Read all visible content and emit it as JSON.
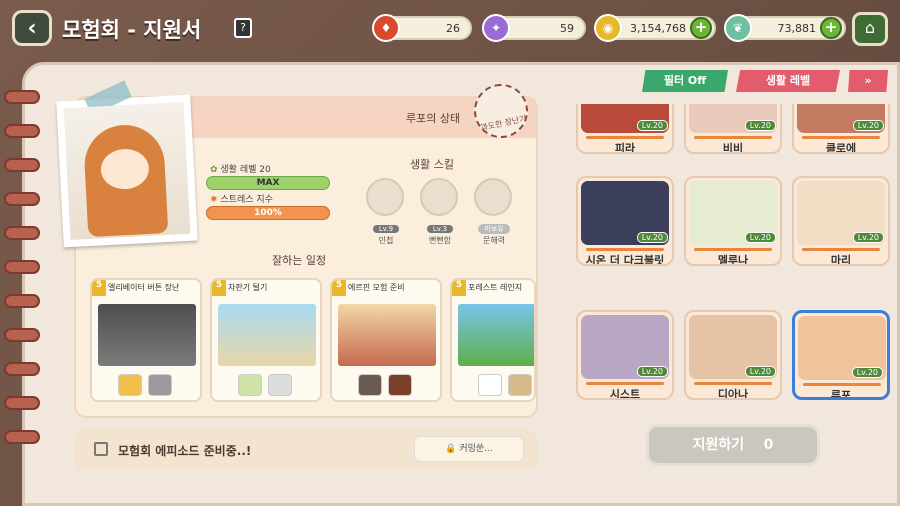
{
  "header": {
    "title": "모험회 - 지원서",
    "help": "?"
  },
  "currencies": [
    {
      "icon": "lantern-icon",
      "value": "26",
      "color": "#d94a2c"
    },
    {
      "icon": "purple-gem-icon",
      "value": "59",
      "color": "#9c6ad6"
    },
    {
      "icon": "gold-coin-icon",
      "value": "3,154,768",
      "color": "#e6b82a"
    },
    {
      "icon": "leaf-icon",
      "value": "73,881",
      "color": "#6ec0a0"
    }
  ],
  "status": {
    "title": "루포의 상태",
    "stamp": "과도한 장난기",
    "life_level": "생활 레벨 20",
    "max": "MAX",
    "stress": "스트레스 지수",
    "stress_value": "100%",
    "stress_level": 1.0
  },
  "skills": {
    "title": "생활 스킬",
    "items": [
      {
        "lv": "Lv.9",
        "name": "민첩"
      },
      {
        "lv": "Lv.3",
        "name": "뻔뻔함"
      },
      {
        "lv": "미보유",
        "name": "문해력"
      }
    ]
  },
  "schedule": {
    "title": "잘하는 일정",
    "items": [
      {
        "num": "5",
        "name": "엘리베이터 버튼 장난",
        "color": "#6b6b6b"
      },
      {
        "num": "5",
        "name": "자판기 털기",
        "color": "#8fc7e8"
      },
      {
        "num": "5",
        "name": "에르핀 모험 준비",
        "color": "#c56a4e"
      },
      {
        "num": "5",
        "name": "포레스트 레인지",
        "color": "#79c4e8"
      }
    ]
  },
  "episode": {
    "text": "모험회 에피소드 준비중..!",
    "coming": "커밍쑨..."
  },
  "filters": {
    "filter": "필터 Off",
    "life_level": "생활 레벨",
    "collapse": "»"
  },
  "characters": [
    {
      "name": "피라",
      "lv": "Lv.20"
    },
    {
      "name": "비비",
      "lv": "Lv.20"
    },
    {
      "name": "클로에",
      "lv": "Lv.20"
    },
    {
      "name": "시온 더 다크불릿",
      "lv": "Lv.20"
    },
    {
      "name": "멜루나",
      "lv": "Lv.20"
    },
    {
      "name": "마리",
      "lv": "Lv.20"
    },
    {
      "name": "시스트",
      "lv": "Lv.20"
    },
    {
      "name": "디아나",
      "lv": "Lv.20"
    },
    {
      "name": "루포",
      "lv": "Lv.20"
    }
  ],
  "support": {
    "label": "지원하기",
    "count": "0"
  }
}
